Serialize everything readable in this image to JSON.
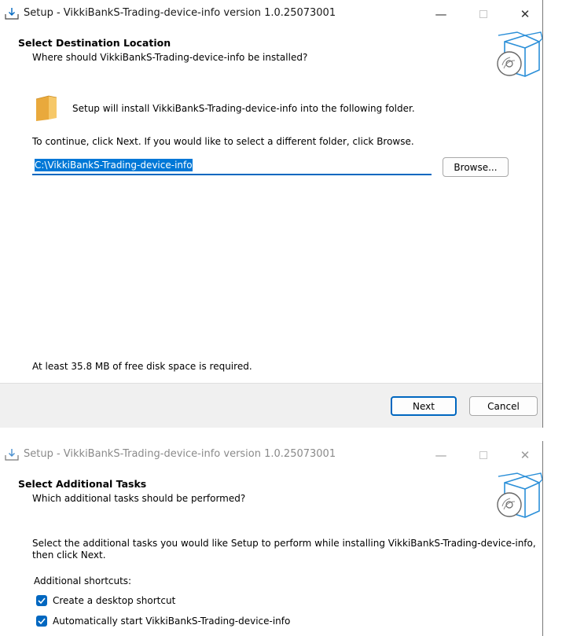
{
  "window1": {
    "title": "Setup - VikkiBankS-Trading-device-info version 1.0.25073001",
    "header_title": "Select Destination Location",
    "header_subtitle": "Where should VikkiBankS-Trading-device-info be installed?",
    "install_info": "Setup will install VikkiBankS-Trading-device-info into the following folder.",
    "instruction": "To continue, click Next. If you would like to select a different folder, click Browse.",
    "path_value": "C:\\VikkiBankS-Trading-device-info",
    "browse_label": "Browse...",
    "disk_space": "At least 35.8 MB of free disk space is required.",
    "next_label": "Next",
    "cancel_label": "Cancel"
  },
  "window2": {
    "title": "Setup - VikkiBankS-Trading-device-info version 1.0.25073001",
    "header_title": "Select Additional Tasks",
    "header_subtitle": "Which additional tasks should be performed?",
    "instruction_line1": "Select the additional tasks you would like Setup to perform while installing VikkiBankS-Trading-device-info,",
    "instruction_line2": "then click Next.",
    "group_label": "Additional shortcuts:",
    "tasks": [
      {
        "label": "Create a desktop shortcut",
        "checked": true
      },
      {
        "label": "Automatically start VikkiBankS-Trading-device-info",
        "checked": true
      }
    ]
  },
  "titlebar_controls": {
    "minimize": "—",
    "close": "✕"
  },
  "colors": {
    "accent": "#0067c0",
    "selection": "#0078d7",
    "footer": "#f0f0f0",
    "folder": "#f2b64c"
  }
}
